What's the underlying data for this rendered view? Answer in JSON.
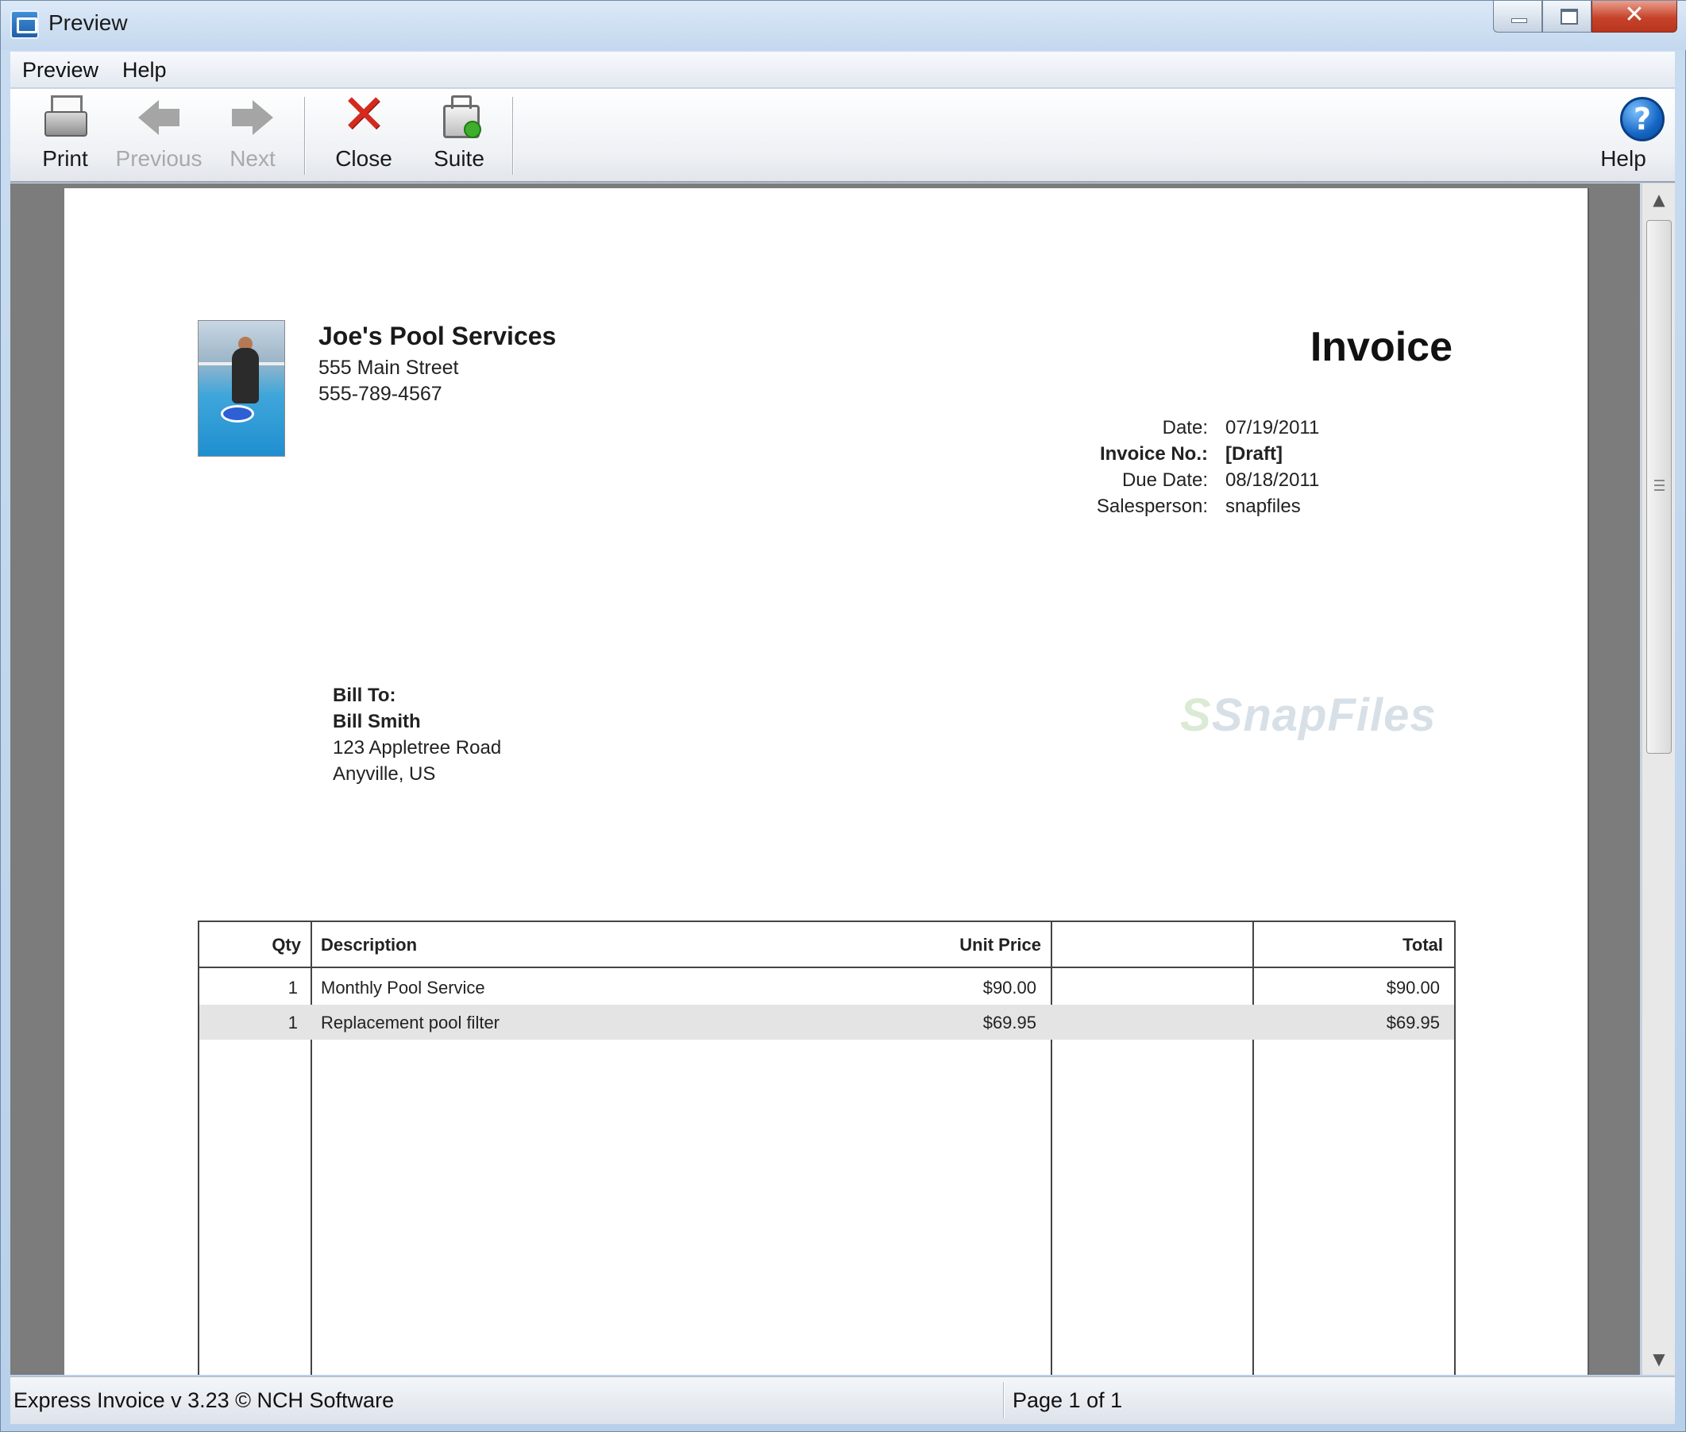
{
  "window": {
    "title": "Preview",
    "close_glyph": "✕"
  },
  "menu": [
    "Preview",
    "Help"
  ],
  "toolbar": {
    "print": "Print",
    "previous": "Previous",
    "next": "Next",
    "close": "Close",
    "suite": "Suite",
    "help": "Help",
    "help_glyph": "?",
    "close_glyph": "✕"
  },
  "invoice": {
    "company": {
      "name": "Joe's Pool Services",
      "address": "555 Main Street",
      "phone": "555-789-4567"
    },
    "title": "Invoice",
    "meta": [
      {
        "label": "Date:",
        "value": "07/19/2011"
      },
      {
        "label": "Invoice No.:",
        "value": "[Draft]"
      },
      {
        "label": "Due Date:",
        "value": "08/18/2011"
      },
      {
        "label": "Salesperson:",
        "value": "snapfiles"
      }
    ],
    "bill_to": {
      "heading": "Bill To:",
      "name": "Bill Smith",
      "address1": "123 Appletree Road",
      "address2": "Anyville, US"
    },
    "watermark": {
      "mark": "S",
      "text": "SnapFiles"
    },
    "columns": [
      "Qty",
      "Description",
      "Unit Price",
      "Total"
    ],
    "items": [
      {
        "qty": "1",
        "description": "Monthly Pool Service",
        "unit_price": "$90.00",
        "total": "$90.00"
      },
      {
        "qty": "1",
        "description": "Replacement pool filter",
        "unit_price": "$69.95",
        "total": "$69.95"
      }
    ]
  },
  "scrollbar": {
    "up": "▲",
    "down": "▼"
  },
  "status": {
    "left": "Express Invoice v 3.23 © NCH Software",
    "right": "Page 1 of 1"
  },
  "icons": {
    "app": "invoice-app-icon",
    "print": "printer-icon",
    "previous": "arrow-left-icon",
    "next": "arrow-right-icon",
    "close": "red-x-icon",
    "suite": "briefcase-icon",
    "help": "question-mark-icon"
  }
}
